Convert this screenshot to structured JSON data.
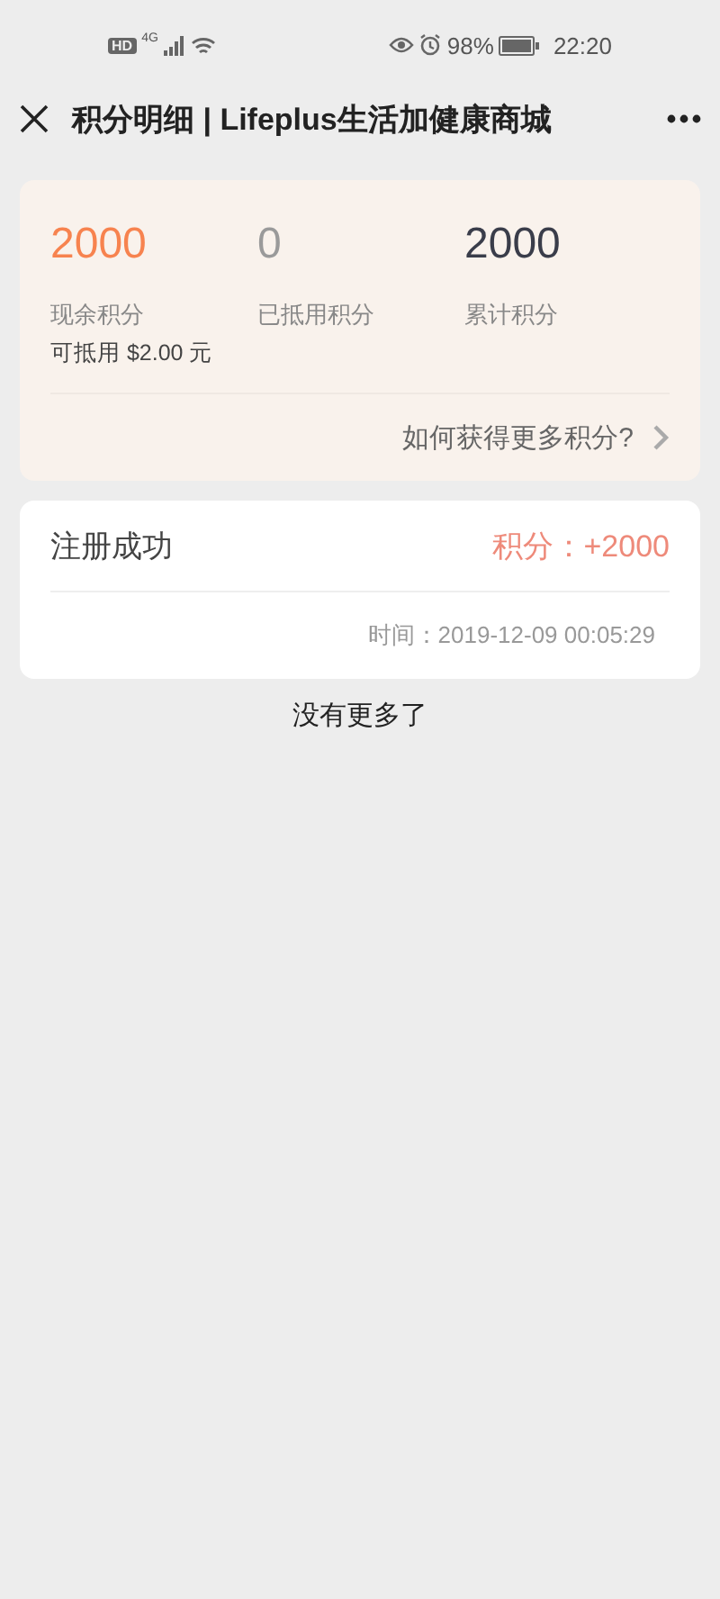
{
  "status_bar": {
    "hd": "HD",
    "network": "4G",
    "battery": "98%",
    "time": "22:20"
  },
  "header": {
    "title": "积分明细 | Lifeplus生活加健康商城"
  },
  "summary": {
    "stats": [
      {
        "value": "2000",
        "label": "现余积分",
        "color": "#f7834f",
        "note": "可抵用 $2.00 元"
      },
      {
        "value": "0",
        "label": "已抵用积分",
        "color": "#9a9a9a"
      },
      {
        "value": "2000",
        "label": "累计积分",
        "color": "#3a3d4a"
      }
    ],
    "link": "如何获得更多积分?"
  },
  "records": [
    {
      "title": "注册成功",
      "points": "积分：+2000",
      "time": "时间：2019-12-09 00:05:29"
    }
  ],
  "footer": "没有更多了"
}
